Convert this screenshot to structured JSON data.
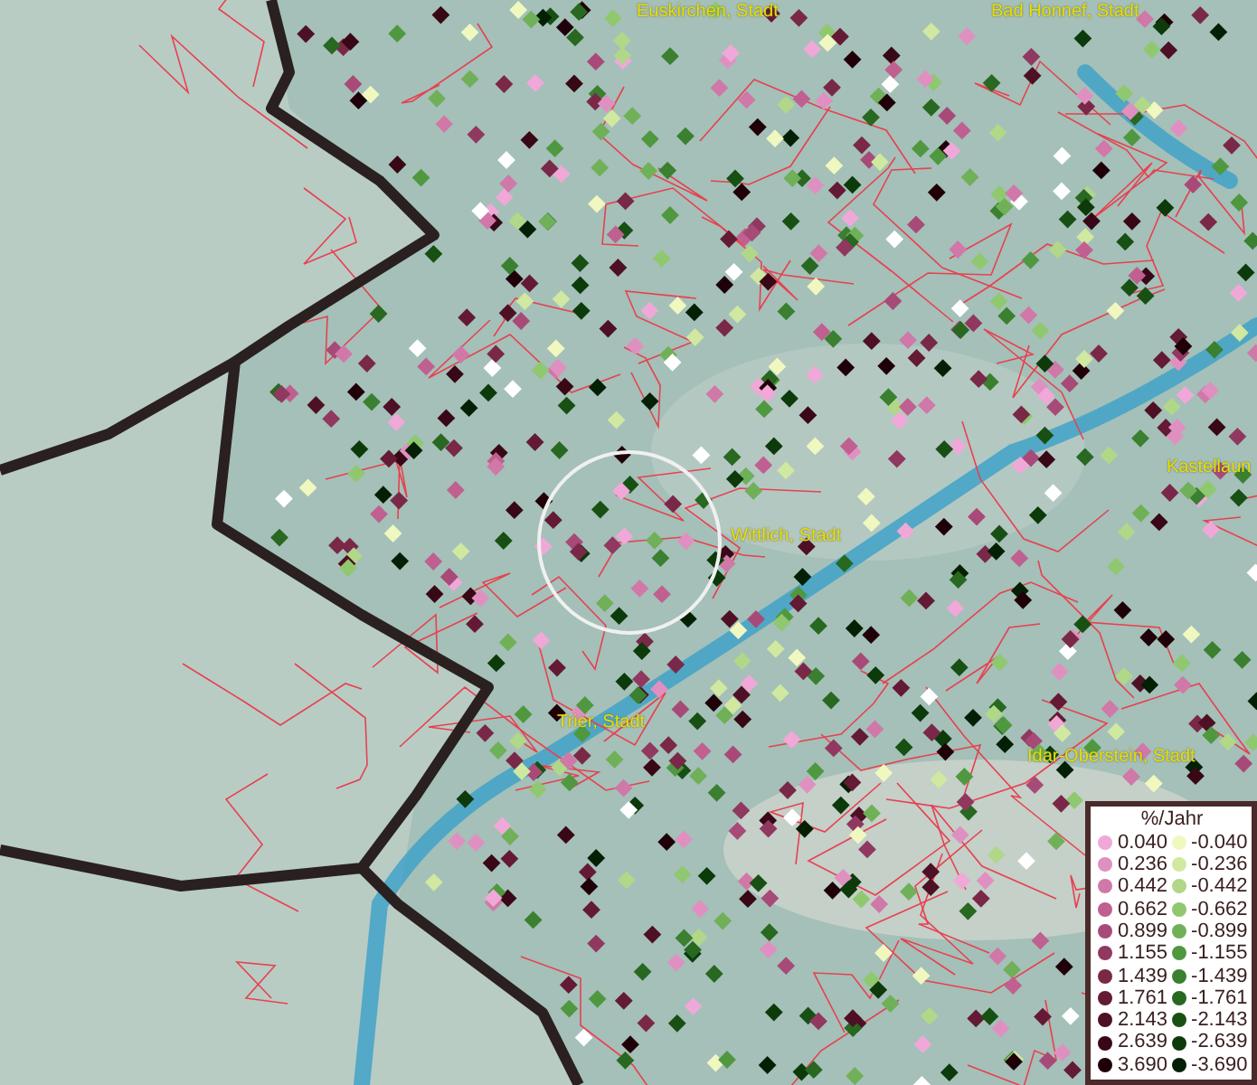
{
  "map": {
    "place_labels": [
      {
        "text": "Euskirchen, Stadt"
      },
      {
        "text": "Bad Honnef, Stadt"
      },
      {
        "text": "Kastellaun"
      },
      {
        "text": "Wittlich, Stadt"
      },
      {
        "text": "Trier, Stadt"
      },
      {
        "text": "Idar-Oberstein, Stadt"
      }
    ],
    "legend": {
      "title": "%/Jahr",
      "items": [
        {
          "label": "0.040",
          "color": "#f0a8d8"
        },
        {
          "label": "-0.040",
          "color": "#f0f8c0"
        },
        {
          "label": "0.236",
          "color": "#e090c0"
        },
        {
          "label": "-0.236",
          "color": "#d0e8a0"
        },
        {
          "label": "0.442",
          "color": "#d078a8"
        },
        {
          "label": "-0.442",
          "color": "#b0d888"
        },
        {
          "label": "0.662",
          "color": "#c06090"
        },
        {
          "label": "-0.662",
          "color": "#90c870"
        },
        {
          "label": "0.899",
          "color": "#a84a78"
        },
        {
          "label": "-0.899",
          "color": "#70b058"
        },
        {
          "label": "1.155",
          "color": "#903860"
        },
        {
          "label": "-1.155",
          "color": "#509840"
        },
        {
          "label": "1.439",
          "color": "#7a2848"
        },
        {
          "label": "-1.439",
          "color": "#3a8030"
        },
        {
          "label": "1.761",
          "color": "#641a34"
        },
        {
          "label": "-1.761",
          "color": "#286820"
        },
        {
          "label": "2.143",
          "color": "#4e1024"
        },
        {
          "label": "-2.143",
          "color": "#185014"
        },
        {
          "label": "2.639",
          "color": "#380816"
        },
        {
          "label": "-2.639",
          "color": "#0c3a0a"
        },
        {
          "label": "3.690",
          "color": "#200008"
        },
        {
          "label": "-3.690",
          "color": "#042004"
        }
      ]
    }
  }
}
